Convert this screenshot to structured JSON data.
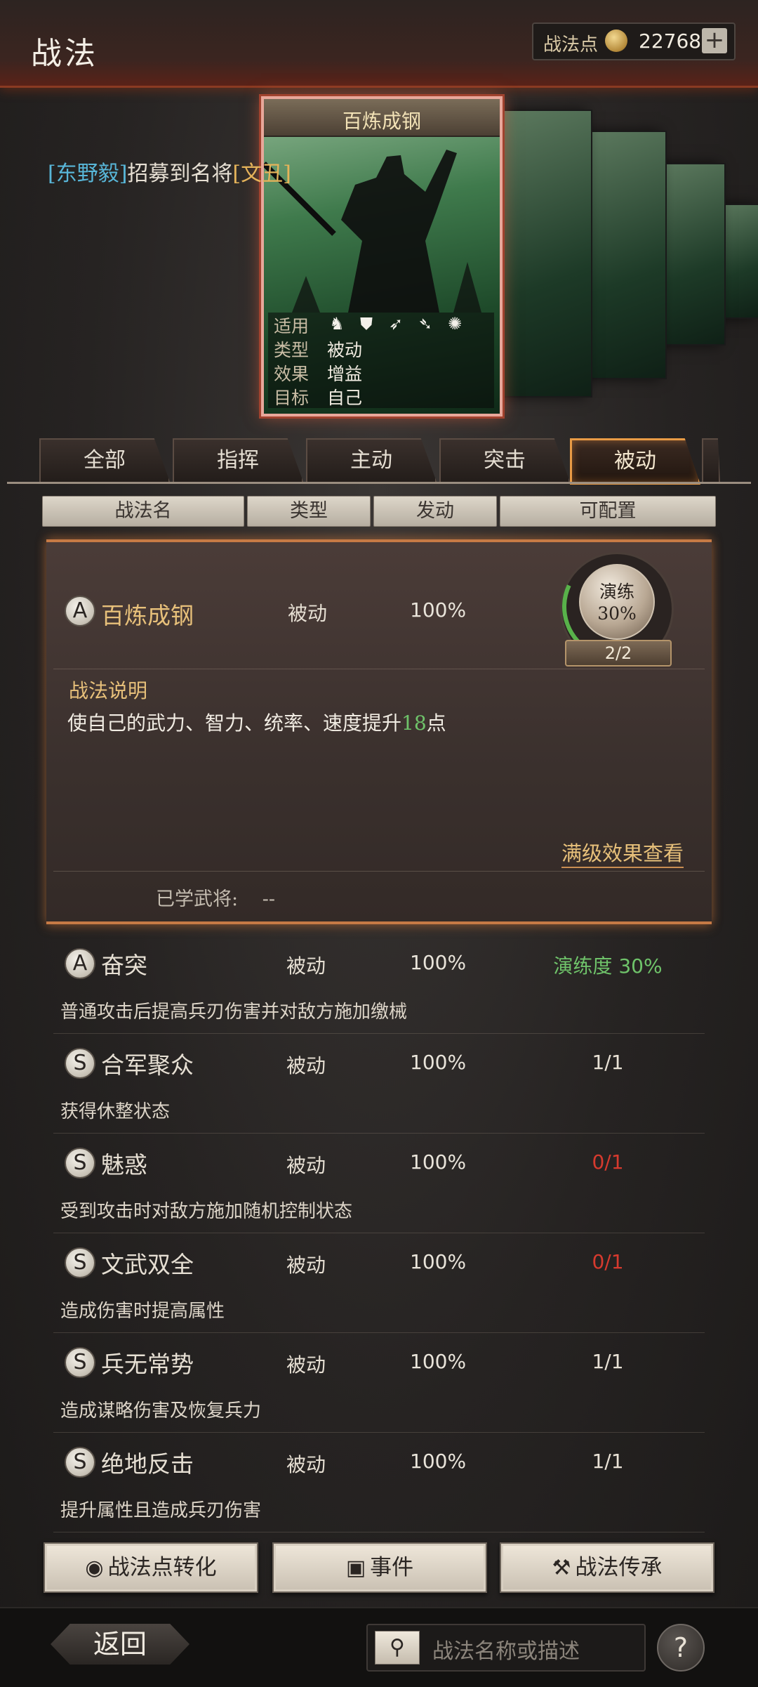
{
  "header": {
    "title": "战法",
    "points_label": "战法点",
    "points_value": "22768",
    "plus_label": "+"
  },
  "recruit_message": {
    "player": "[东野毅]",
    "middle": "招募到名将",
    "general": "[文丑]"
  },
  "featured_card": {
    "title": "百炼成钢",
    "info": [
      {
        "label": "适用",
        "value": ""
      },
      {
        "label": "类型",
        "value": "被动"
      },
      {
        "label": "效果",
        "value": "增益"
      },
      {
        "label": "目标",
        "value": "自己"
      }
    ],
    "applicable_icons": [
      "cavalry-icon",
      "shield-icon",
      "bow-icon",
      "spear-icon",
      "wheel-icon"
    ]
  },
  "tabs": [
    {
      "label": "全部",
      "active": false
    },
    {
      "label": "指挥",
      "active": false
    },
    {
      "label": "主动",
      "active": false
    },
    {
      "label": "突击",
      "active": false
    },
    {
      "label": "被动",
      "active": true
    }
  ],
  "columns": {
    "name": "战法名",
    "type": "类型",
    "trigger": "发动",
    "config": "可配置"
  },
  "expanded": {
    "grade": "A",
    "name": "百炼成钢",
    "type": "被动",
    "rate": "100%",
    "train_label": "演练",
    "train_pct": "30%",
    "train_count": "2/2",
    "desc_title": "战法说明",
    "desc_prefix": "使自己的武力、智力、统率、速度提升",
    "desc_number": "18",
    "desc_suffix": "点",
    "full_effect_link": "满级效果查看",
    "learned_label": "已学武将:",
    "learned_value": "--"
  },
  "rows": [
    {
      "grade": "A",
      "name": "奋突",
      "type": "被动",
      "rate": "100%",
      "right": "演练度 30%",
      "right_color": "green",
      "desc": "普通攻击后提高兵刃伤害并对敌方施加缴械"
    },
    {
      "grade": "S",
      "name": "合军聚众",
      "type": "被动",
      "rate": "100%",
      "right": "1/1",
      "right_color": "white",
      "desc": "获得休整状态"
    },
    {
      "grade": "S",
      "name": "魅惑",
      "type": "被动",
      "rate": "100%",
      "right": "0/1",
      "right_color": "red",
      "desc": "受到攻击时对敌方施加随机控制状态"
    },
    {
      "grade": "S",
      "name": "文武双全",
      "type": "被动",
      "rate": "100%",
      "right": "0/1",
      "right_color": "red",
      "desc": "造成伤害时提高属性"
    },
    {
      "grade": "S",
      "name": "兵无常势",
      "type": "被动",
      "rate": "100%",
      "right": "1/1",
      "right_color": "white",
      "desc": "造成谋略伤害及恢复兵力"
    },
    {
      "grade": "S",
      "name": "绝地反击",
      "type": "被动",
      "rate": "100%",
      "right": "1/1",
      "right_color": "white",
      "desc": "提升属性且造成兵刃伤害"
    }
  ],
  "actions": {
    "convert": "战法点转化",
    "events": "事件",
    "inherit": "战法传承"
  },
  "footer": {
    "back": "返回",
    "search_placeholder": "战法名称或描述",
    "help": "?"
  },
  "colors": {
    "accent_gold": "#e7c07a",
    "active_tab_border": "#e99b45",
    "green": "#6fc36a",
    "red": "#d63a2e"
  }
}
